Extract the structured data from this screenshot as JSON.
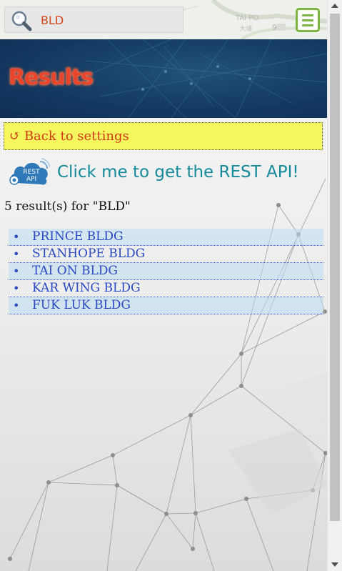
{
  "search": {
    "value": "BLD"
  },
  "map": {
    "label_en": "TAI PO",
    "label_zh": "大埔",
    "road_number": "9"
  },
  "header": {
    "title": "Results"
  },
  "back_button": {
    "icon": "↺",
    "label": "Back to settings"
  },
  "rest_api": {
    "icon_line1": "REST",
    "icon_line2": "API",
    "label": "Click me to get the REST API!"
  },
  "result_summary": "5 result(s) for \"BLD\"",
  "results": [
    {
      "bullet": "•",
      "name": "PRINCE BLDG"
    },
    {
      "bullet": "•",
      "name": "STANHOPE BLDG"
    },
    {
      "bullet": "•",
      "name": "TAI ON BLDG"
    },
    {
      "bullet": "•",
      "name": "KAR WING BLDG"
    },
    {
      "bullet": "•",
      "name": "FUK LUK BLDG"
    }
  ],
  "colors": {
    "accent_green": "#7cb342",
    "title_red": "#e8452c",
    "link_blue": "#2a48c4",
    "rest_teal": "#158a9a",
    "back_bg": "#f5f75c"
  }
}
